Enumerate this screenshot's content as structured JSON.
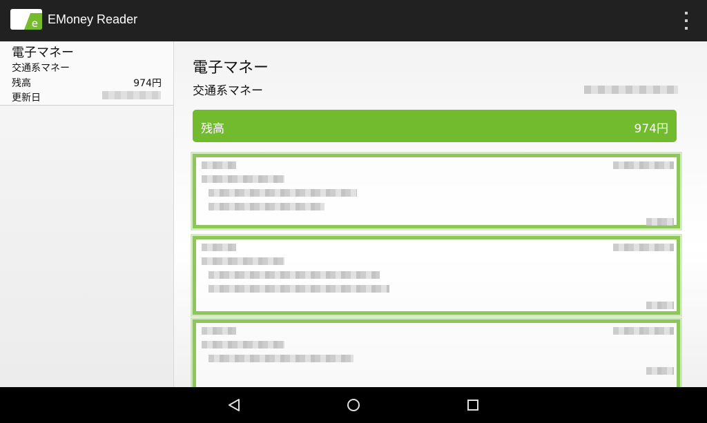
{
  "app": {
    "title": "EMoney Reader",
    "icon_letter": "e",
    "accent_color": "#75bb2d"
  },
  "card_list": [
    {
      "name": "電子マネー",
      "type": "交通系マネー",
      "balance_label": "残高",
      "balance_value": "974円",
      "updated_label": "更新日"
    }
  ],
  "detail": {
    "title": "電子マネー",
    "subtitle": "交通系マネー",
    "balance_label": "残高",
    "balance_value": "974円"
  },
  "icons": {
    "overflow": "overflow-menu-icon",
    "back": "back-icon",
    "home": "home-icon",
    "recents": "recents-icon"
  }
}
